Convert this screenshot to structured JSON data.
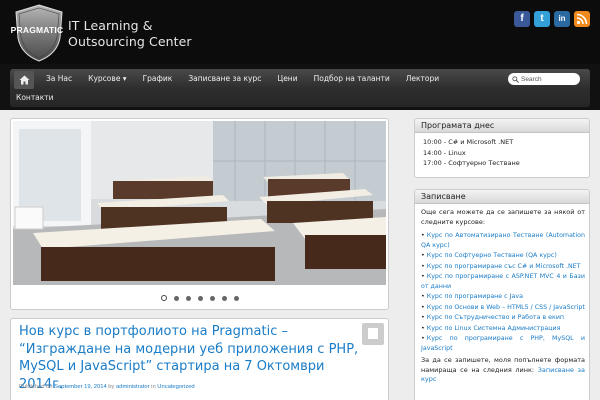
{
  "header": {
    "logo_text": "PRAGMATIC",
    "tagline_line1": "IT Learning &",
    "tagline_line2": "Outsourcing Center"
  },
  "social": {
    "facebook": "f",
    "twitter": "t",
    "linkedin": "in",
    "rss": "rss"
  },
  "nav": {
    "items": [
      "За Нас",
      "Курсове ▾",
      "График",
      "Записване за курс",
      "Цени",
      "Подбор на таланти",
      "Лектори"
    ],
    "row2": [
      "Контакти"
    ],
    "search_placeholder": "Search"
  },
  "slider": {
    "dots_count": 7,
    "active_dot": 1
  },
  "post": {
    "title": "Нов курс в портфолиото на Pragmatic – “Изграждане на модерни уеб приложения с PHP, MySQL и JavaScript” стартира на 7 Октомври 2014г.",
    "meta_prefix": "Published on ",
    "meta_date": "September 19, 2014",
    "meta_by": " by ",
    "meta_author": "administrator",
    "meta_in": " in ",
    "meta_category": "Uncategorized"
  },
  "sidebar": {
    "today_title": "Програмата днес",
    "today_items": [
      "10:00 - C# и Microsoft .NET",
      "14:00 - Linux",
      "17:00 - Софтуерно Тестване"
    ],
    "register_title": "Записване",
    "register_intro": "Още сега можете да се запишете за някой от следните курсове:",
    "register_courses": [
      "Курс по Автоматизирано Тестване (Automation QA курс)",
      "Курс по Софтуерно Тестване (QA курс)",
      "Курс по програмиране със C# и Microsoft .NET",
      "Курс по програмиране с ASP.NET MVC 4 и Бази от данни",
      "Курс по програмиране с Java",
      "Курс по Основи в Web – HTML5 / CSS / JavaScript",
      "Курс по Сътрудничество и Работа в екип",
      "Курс по Linux Системна Администрация",
      "Курс по програмиране с PHP, MySQL и JavaScript"
    ],
    "register_outro": "За да се запишете, моля попълнете формата намираща се на следния линк: ",
    "register_outro_link": "Записване за курс"
  },
  "colors": {
    "accent": "#1a7cc7",
    "header_bg": "#0c0c0c",
    "content_bg": "#ededed"
  }
}
